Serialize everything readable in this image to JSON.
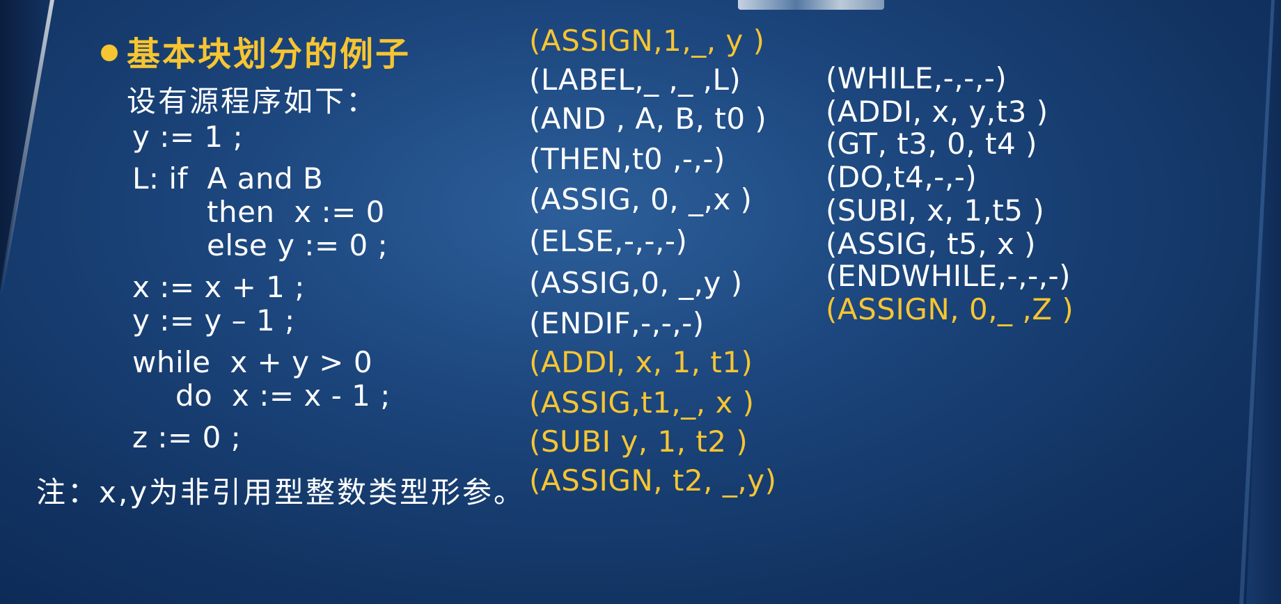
{
  "title": "基本块划分的例子",
  "intro": "设有源程序如下：",
  "source_lines": [
    "y := 1 ;",
    "L: if  A and B",
    "then  x := 0",
    "else y := 0 ;",
    "x := x + 1 ;",
    "y := y – 1 ;",
    "while  x + y > 0",
    "do  x := x - 1 ;",
    "z := 0 ;"
  ],
  "note": "注：x,y为非引用型整数类型形参。",
  "quads_col1": [
    {
      "text": "(ASSIGN,1,_, y )",
      "highlight": true
    },
    {
      "text": "(LABEL,_ ,_ ,L)",
      "highlight": false
    },
    {
      "text": "(AND , A, B, t0 )",
      "highlight": false
    },
    {
      "text": "(THEN,t0 ,-,-)",
      "highlight": false
    },
    {
      "text": "(ASSIG, 0, _,x )",
      "highlight": false
    },
    {
      "text": "(ELSE,-,-,-)",
      "highlight": false
    },
    {
      "text": "(ASSIG,0, _,y )",
      "highlight": false
    },
    {
      "text": "(ENDIF,-,-,-)",
      "highlight": false
    },
    {
      "text": "(ADDI, x, 1, t1)",
      "highlight": true
    },
    {
      "text": "(ASSIG,t1,_, x )",
      "highlight": true
    },
    {
      "text": "(SUBI y, 1, t2 )",
      "highlight": true
    },
    {
      "text": "(ASSIGN, t2, _,y)",
      "highlight": true
    }
  ],
  "quads_col2": [
    {
      "text": "(WHILE,-,-,-)",
      "highlight": false
    },
    {
      "text": "(ADDI, x, y,t3 )",
      "highlight": false
    },
    {
      "text": "(GT, t3, 0, t4 )",
      "highlight": false
    },
    {
      "text": "(DO,t4,-,-)",
      "highlight": false
    },
    {
      "text": "(SUBI, x, 1,t5 )",
      "highlight": false
    },
    {
      "text": "(ASSIG, t5, x )",
      "highlight": false
    },
    {
      "text": "(ENDWHILE,-,-,-)",
      "highlight": false
    },
    {
      "text": "(ASSIGN, 0,_ ,Z )",
      "highlight": true
    }
  ],
  "colors": {
    "background": "#1c467d",
    "text": "#ffffff",
    "highlight": "#f7c531"
  }
}
